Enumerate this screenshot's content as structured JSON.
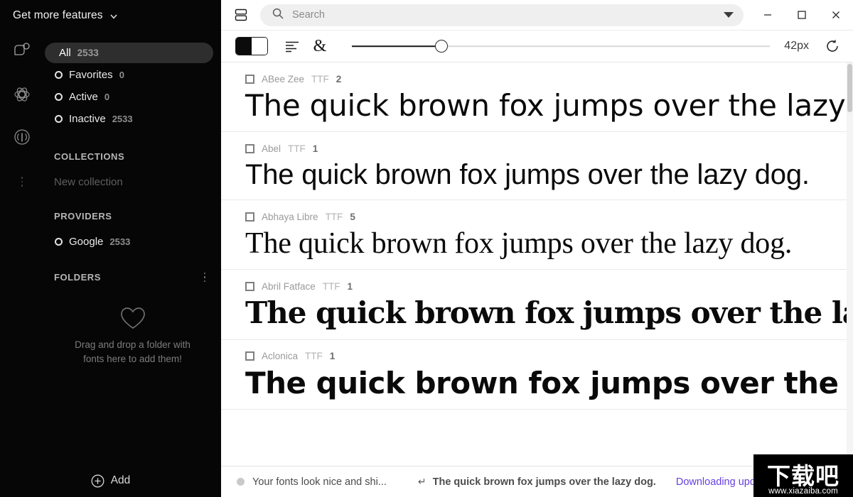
{
  "sidebar": {
    "top_label": "Get more features",
    "rail_icons": [
      "collection-icon",
      "atom-icon",
      "broadcast-icon",
      "more-vertical-icon"
    ],
    "filters": [
      {
        "label": "All",
        "count": "2533",
        "selected": true
      },
      {
        "label": "Favorites",
        "count": "0",
        "selected": false
      },
      {
        "label": "Active",
        "count": "0",
        "selected": false
      },
      {
        "label": "Inactive",
        "count": "2533",
        "selected": false
      }
    ],
    "collections": {
      "header": "COLLECTIONS",
      "new_collection": "New collection"
    },
    "providers": {
      "header": "PROVIDERS",
      "items": [
        {
          "label": "Google",
          "count": "2533"
        }
      ]
    },
    "folders": {
      "header": "FOLDERS",
      "dropzone_text": "Drag and drop a folder with fonts here to add them!"
    },
    "add_button": "Add"
  },
  "titlebar": {
    "view_toggle_icon": "layout-rows-icon",
    "search": {
      "placeholder": "Search",
      "value": "",
      "icon": "search-icon",
      "dropdown_icon": "caret-down-icon"
    },
    "window": {
      "minimize": "minimize-icon",
      "maximize": "maximize-icon",
      "close": "close-icon"
    }
  },
  "toolbar": {
    "contrast_toggle": "black-white-toggle-icon",
    "align_icon": "text-align-left-icon",
    "glyph_icon": "ampersand-icon",
    "size_value": "42px",
    "slider_percent": 21.5,
    "reset_icon": "reset-rotate-icon"
  },
  "fonts": [
    {
      "name": "ABee Zee",
      "format": "TTF",
      "count": "2",
      "sample": "The quick brown fox jumps over the lazy dog.",
      "style": "s-abeezee"
    },
    {
      "name": "Abel",
      "format": "TTF",
      "count": "1",
      "sample": "The quick brown fox jumps over the lazy dog.",
      "style": "s-abel"
    },
    {
      "name": "Abhaya Libre",
      "format": "TTF",
      "count": "5",
      "sample": "The quick brown fox jumps over the lazy dog.",
      "style": "s-abhaya"
    },
    {
      "name": "Abril Fatface",
      "format": "TTF",
      "count": "1",
      "sample": "The quick brown fox jumps over the lazy dog.",
      "style": "s-abril"
    },
    {
      "name": "Aclonica",
      "format": "TTF",
      "count": "1",
      "sample": "The quick brown fox jumps over the lazy dog.",
      "style": "s-aclonica"
    }
  ],
  "statusbar": {
    "message": "Your fonts look nice and shi...",
    "enter_symbol": "↵",
    "preview_text": "The quick brown fox jumps over the lazy dog.",
    "link": "Downloading upd"
  },
  "watermark": {
    "cn": "下载吧",
    "url": "www.xiazaiba.com"
  },
  "colors": {
    "sidebar_bg": "#060606",
    "pill_bg": "#2e2e2e",
    "link": "#6640e0",
    "search_bg": "#efefef"
  }
}
